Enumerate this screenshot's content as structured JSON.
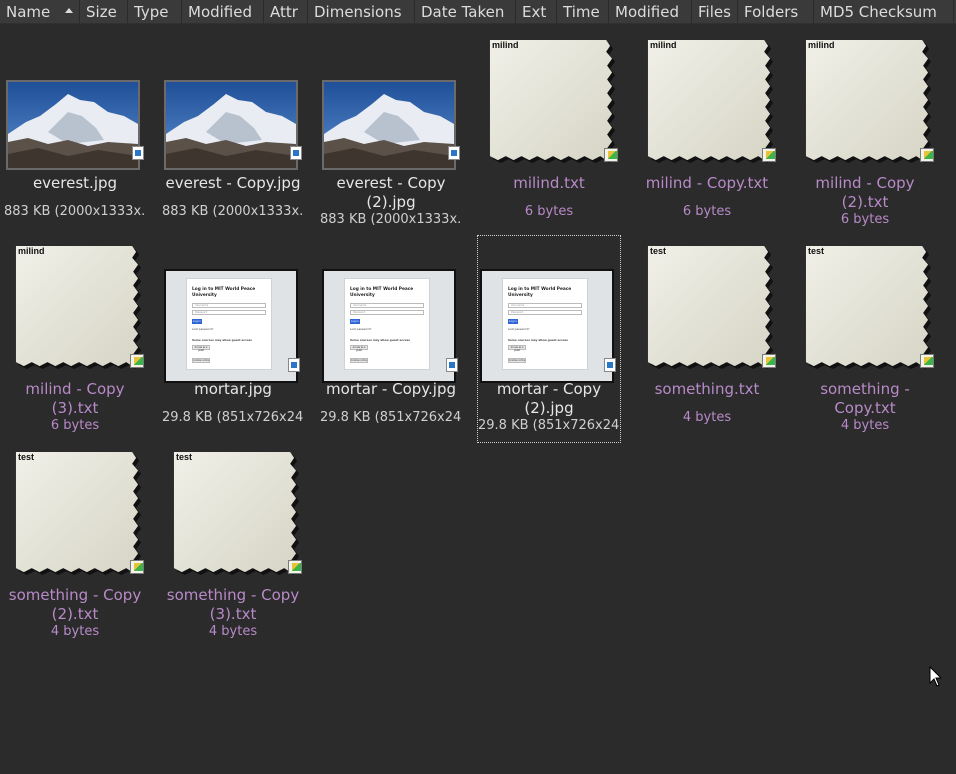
{
  "columns": [
    {
      "label": "Name",
      "sorted": true
    },
    {
      "label": "Size"
    },
    {
      "label": "Type"
    },
    {
      "label": "Modified"
    },
    {
      "label": "Attr"
    },
    {
      "label": "Dimensions"
    },
    {
      "label": "Date Taken"
    },
    {
      "label": "Ext"
    },
    {
      "label": "Time"
    },
    {
      "label": "Modified"
    },
    {
      "label": "Files"
    },
    {
      "label": "Folders"
    },
    {
      "label": "MD5 Checksum"
    }
  ],
  "files": [
    {
      "name": "everest.jpg",
      "info": "883 KB (2000x1333x...",
      "kind": "photo"
    },
    {
      "name": "everest - Copy.jpg",
      "info": "883 KB (2000x1333x...",
      "kind": "photo"
    },
    {
      "name": "everest - Copy (2).jpg",
      "info": "883 KB (2000x1333x...",
      "kind": "photo"
    },
    {
      "name": "milind.txt",
      "info": "6 bytes",
      "kind": "text",
      "preview": "milind"
    },
    {
      "name": "milind - Copy.txt",
      "info": "6 bytes",
      "kind": "text",
      "preview": "milind"
    },
    {
      "name": "milind - Copy (2).txt",
      "info": "6 bytes",
      "kind": "text",
      "preview": "milind"
    },
    {
      "name": "milind - Copy (3).txt",
      "info": "6 bytes",
      "kind": "text",
      "preview": "milind"
    },
    {
      "name": "mortar.jpg",
      "info": "29.8 KB (851x726x24)",
      "kind": "screenshot"
    },
    {
      "name": "mortar - Copy.jpg",
      "info": "29.8 KB (851x726x24)",
      "kind": "screenshot"
    },
    {
      "name": "mortar - Copy (2).jpg",
      "info": "29.8 KB (851x726x24)",
      "kind": "screenshot",
      "selected": true
    },
    {
      "name": "something.txt",
      "info": "4 bytes",
      "kind": "text",
      "preview": "test"
    },
    {
      "name": "something - Copy.txt",
      "info": "4 bytes",
      "kind": "text",
      "preview": "test"
    },
    {
      "name": "something - Copy (2).txt",
      "info": "4 bytes",
      "kind": "text",
      "preview": "test"
    },
    {
      "name": "something - Copy (3).txt",
      "info": "4 bytes",
      "kind": "text",
      "preview": "test"
    }
  ],
  "thumbnail_screenshot": {
    "title": "Log in to MIT World Peace University",
    "username": "Username",
    "password": "Password",
    "login": "Log in",
    "lost": "Lost password?",
    "guest_note": "Some courses may allow guest access",
    "guest_btn": "Access as a guest",
    "cookies_btn": "Cookies notice"
  },
  "colors": {
    "background": "#2b2b2b",
    "header": "#3a3a3a",
    "text_file_name": "#b88ac8"
  },
  "icons": {
    "sort": "sort-ascending-icon",
    "image_badge": "image-file-icon",
    "text_badge": "text-file-icon",
    "cursor": "mouse-cursor-icon"
  }
}
